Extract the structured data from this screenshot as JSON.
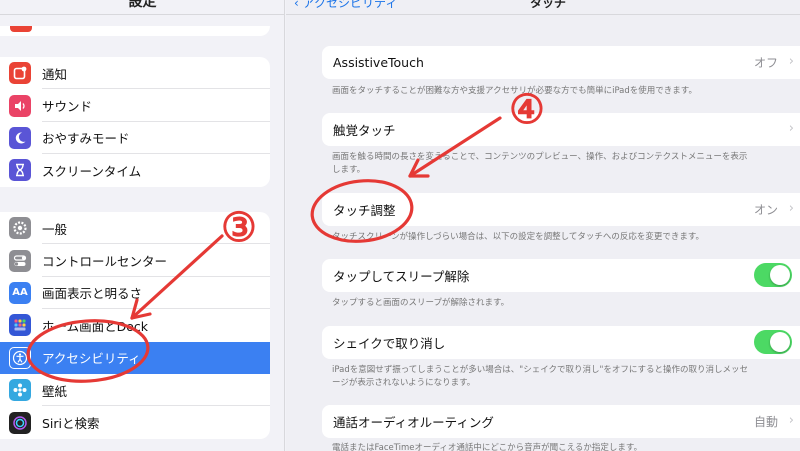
{
  "sidebar": {
    "title": "設定",
    "group1": [
      {
        "label": "通知",
        "icon": "notification-icon",
        "color": "#ea4335"
      },
      {
        "label": "サウンド",
        "icon": "sound-icon",
        "color": "#ea4366"
      },
      {
        "label": "おやすみモード",
        "icon": "moon-icon",
        "color": "#5a55d6"
      },
      {
        "label": "スクリーンタイム",
        "icon": "hourglass-icon",
        "color": "#5a55d6"
      }
    ],
    "group2": [
      {
        "label": "一般",
        "icon": "gear-icon",
        "color": "#8e8e93"
      },
      {
        "label": "コントロールセンター",
        "icon": "toggles-icon",
        "color": "#8e8e93"
      },
      {
        "label": "画面表示と明るさ",
        "icon": "text-size-icon",
        "color": "#3b80f2"
      },
      {
        "label": "ホーム画面とDock",
        "icon": "home-grid-icon",
        "color": "#3457d6"
      },
      {
        "label": "アクセシビリティ",
        "icon": "accessibility-icon",
        "color": "#3b80f2",
        "selected": true
      },
      {
        "label": "壁紙",
        "icon": "wallpaper-icon",
        "color": "#35a8e0"
      },
      {
        "label": "Siriと検索",
        "icon": "siri-icon",
        "color": "#222222"
      }
    ]
  },
  "detail": {
    "back_label": "アクセシビリティ",
    "title": "タッチ",
    "rows": [
      {
        "label": "AssistiveTouch",
        "value": "オフ",
        "footer": "画面をタッチすることが困難な方や支援アクセサリが必要な方でも簡単にiPadを使用できます。"
      },
      {
        "label": "触覚タッチ",
        "value": "",
        "footer": "画面を触る時間の長さを変えることで、コンテンツのプレビュー、操作、およびコンテクストメニューを表示します。"
      },
      {
        "label": "タッチ調整",
        "value": "オン",
        "footer": "タッチスクリーンが操作しづらい場合は、以下の設定を調整してタッチへの反応を変更できます。"
      },
      {
        "label": "タップしてスリープ解除",
        "toggle": true,
        "footer": "タップすると画面のスリープが解除されます。"
      },
      {
        "label": "シェイクで取り消し",
        "toggle": true,
        "footer": "iPadを意図せず振ってしまうことが多い場合は、\"シェイクで取り消し\"をオフにすると操作の取り消しメッセージが表示されないようになります。"
      },
      {
        "label": "通話オーディオルーティング",
        "value": "自動",
        "footer": "電話またはFaceTimeオーディオ通話中にどこから音声が聞こえるか指定します。"
      }
    ]
  },
  "annotations": {
    "step3": "③",
    "step4": "④",
    "color": "#e53935"
  },
  "colors": {
    "accent": "#3b80f2",
    "toggle_on": "#4cd964"
  }
}
